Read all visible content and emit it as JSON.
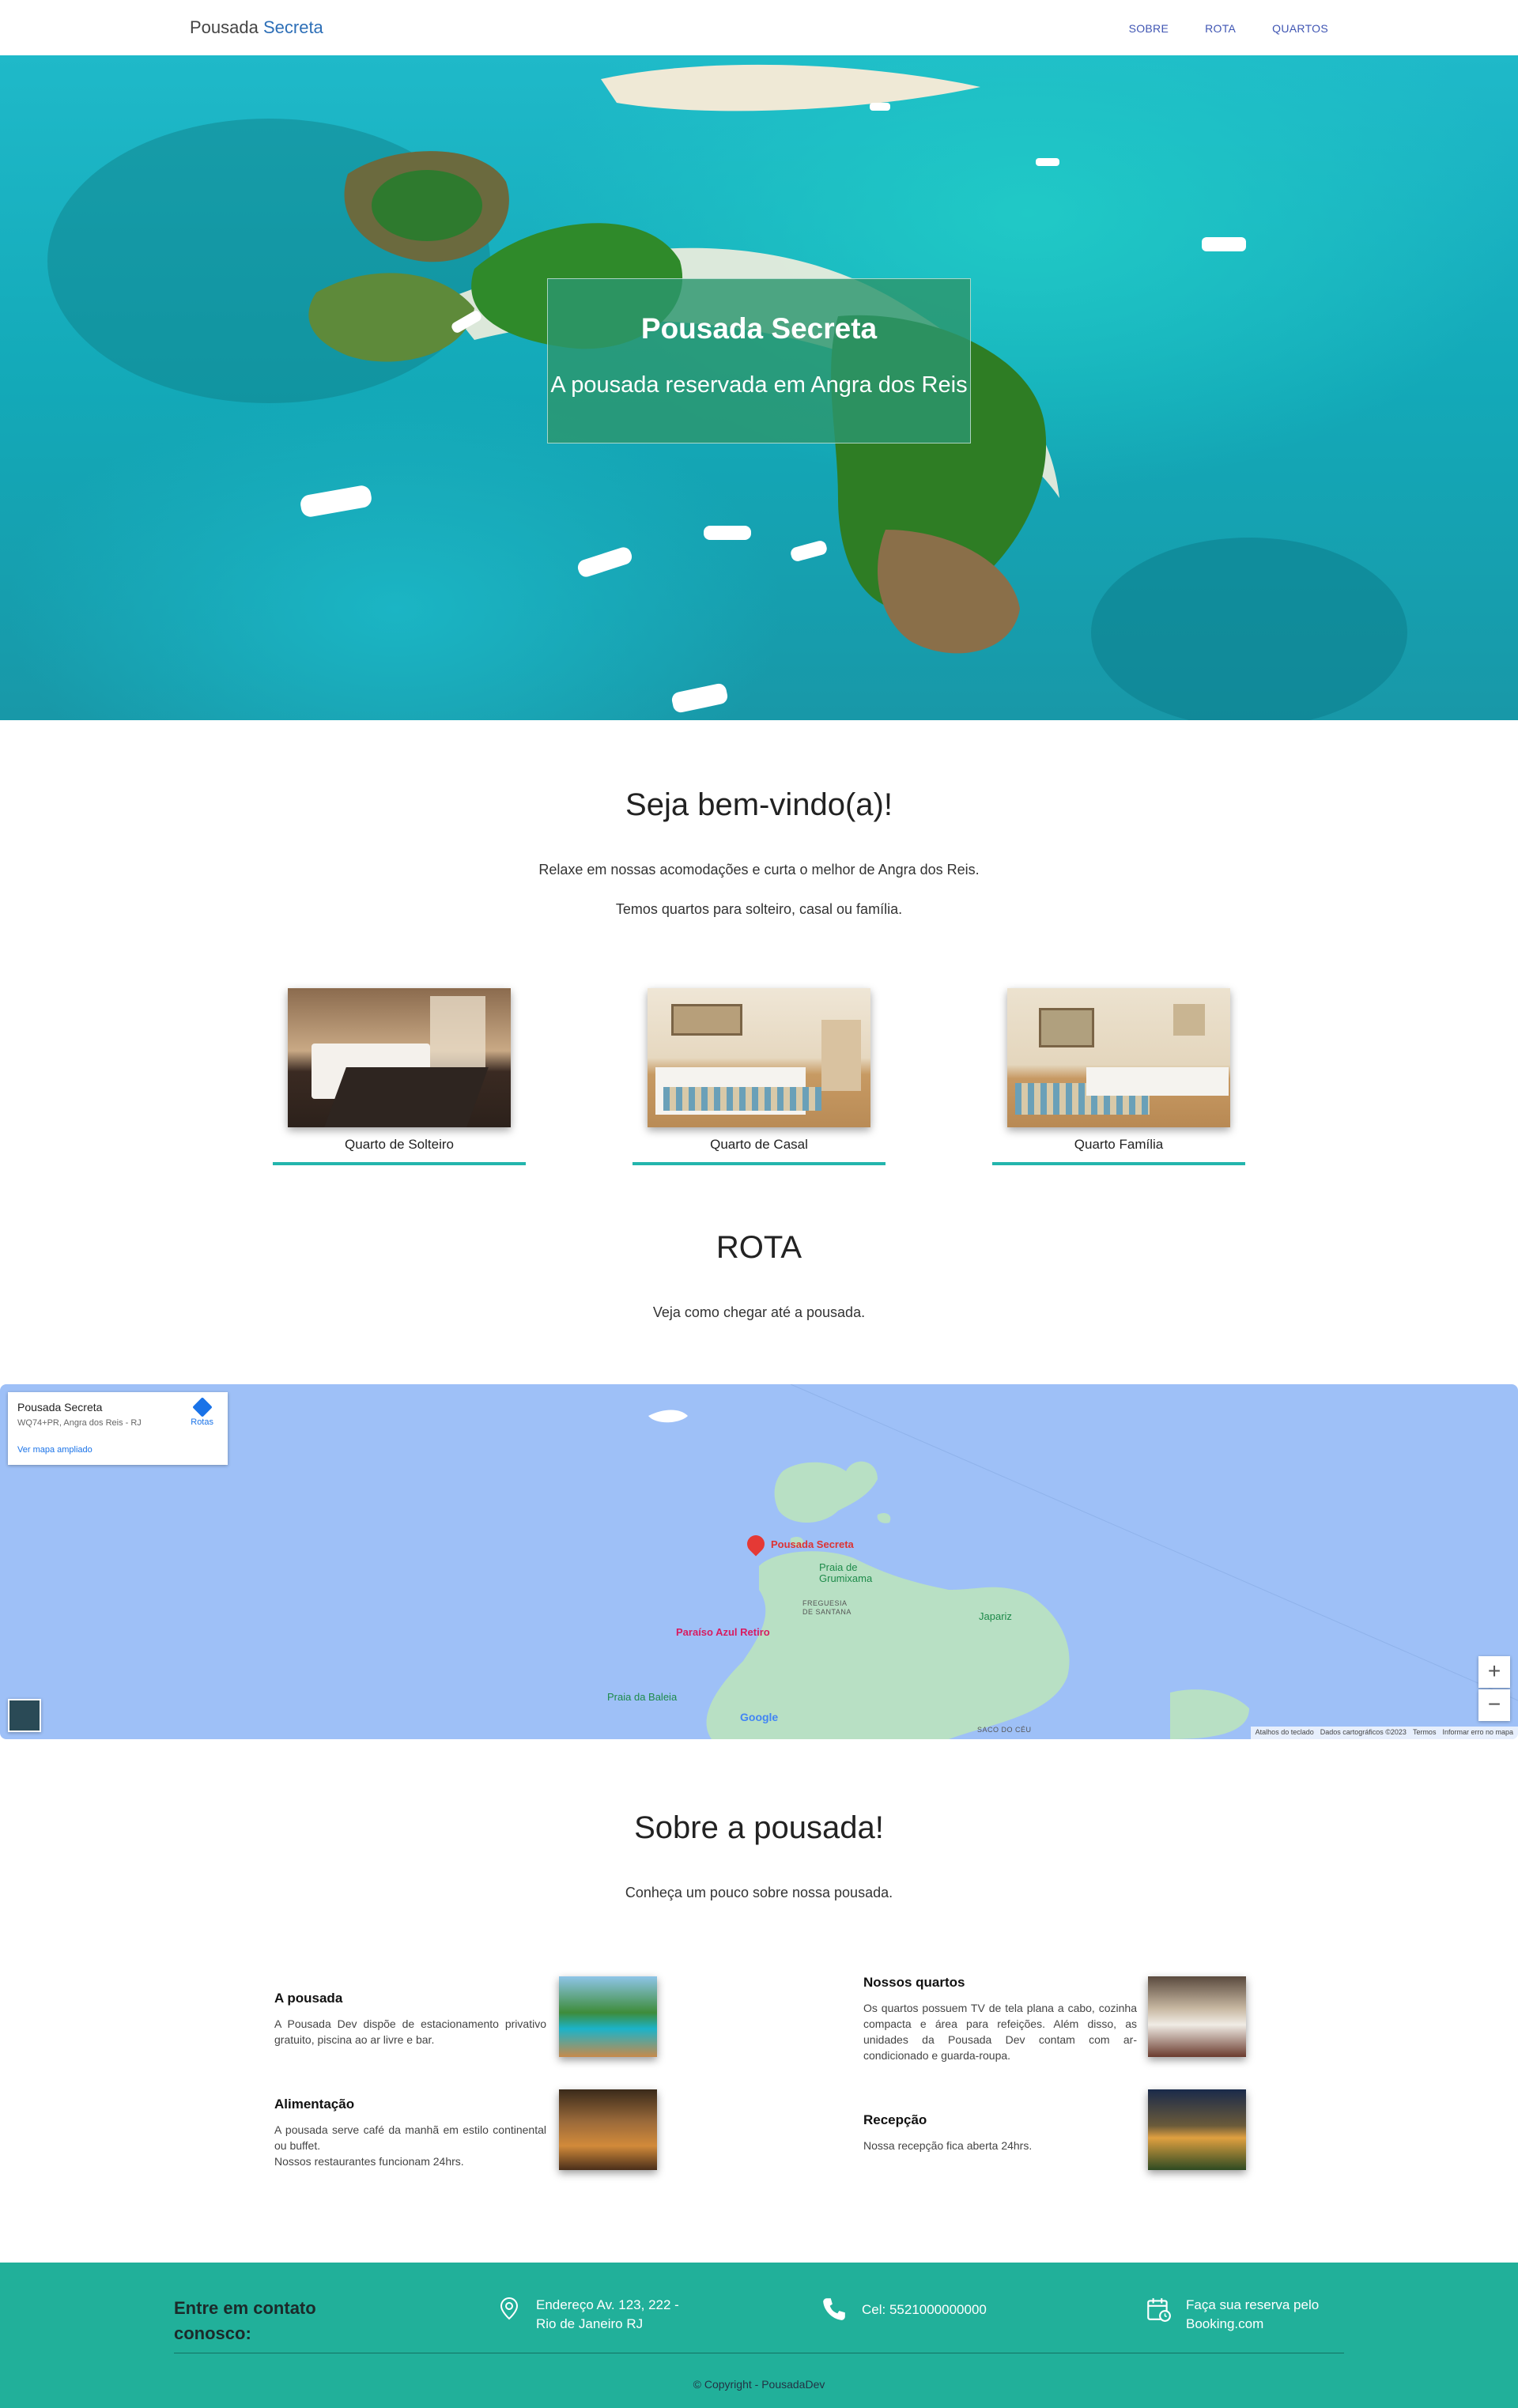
{
  "nav": {
    "brand_main": "Pousada ",
    "brand_accent": "Secreta",
    "links": [
      "SOBRE",
      "ROTA",
      "QUARTOS"
    ]
  },
  "hero": {
    "title": "Pousada Secreta",
    "subtitle": "A pousada reservada em Angra dos Reis"
  },
  "welcome": {
    "title": "Seja bem-vindo(a)!",
    "line1": "Relaxe em nossas acomodações e curta o melhor de Angra dos Reis.",
    "line2": "Temos quartos para solteiro, casal ou família."
  },
  "rooms": [
    {
      "label": "Quarto de Solteiro"
    },
    {
      "label": "Quarto de Casal"
    },
    {
      "label": "Quarto Família"
    }
  ],
  "route": {
    "title": "ROTA",
    "text": "Veja como chegar até a pousada."
  },
  "map": {
    "place_name": "Pousada Secreta",
    "address": "WQ74+PR, Angra dos Reis - RJ",
    "larger_map_link": "Ver mapa ampliado",
    "directions_label": "Rotas",
    "labels": {
      "pin": "Pousada Secreta",
      "beach1": "Praia de Grumixama",
      "district": "FREGUESIA DE SANTANA",
      "hotel": "Paraíso Azul Retiro",
      "japariz": "Japariz",
      "baleia": "Praia da Baleia",
      "saco": "SACO DO CÉU",
      "google": "Google"
    },
    "footer": [
      "Atalhos do teclado",
      "Dados cartográficos ©2023",
      "Termos",
      "Informar erro no mapa"
    ],
    "zoom_in": "+",
    "zoom_out": "−"
  },
  "about": {
    "title": "Sobre a pousada!",
    "text": "Conheça um pouco sobre nossa pousada.",
    "items": [
      {
        "heading": "A pousada",
        "body": "A Pousada Dev dispõe de estacionamento privativo gratuito, piscina ao ar livre e bar."
      },
      {
        "heading": "Nossos quartos",
        "body": "Os quartos possuem TV de tela plana a cabo, cozinha compacta e área para refeições. Além disso, as unidades da Pousada Dev contam com ar-condicionado e guarda-roupa."
      },
      {
        "heading": "Alimentação",
        "body": "A pousada serve café da manhã em estilo continental ou buffet.",
        "body2": "Nossos restaurantes funcionam 24hrs."
      },
      {
        "heading": "Recepção",
        "body": "Nossa recepção fica aberta 24hrs."
      }
    ]
  },
  "footer": {
    "contact_title": "Entre em contato conosco:",
    "address_line1": "Endereço Av. 123, 222 -",
    "address_line2": "Rio de Janeiro RJ",
    "phone": "Cel: 5521000000000",
    "booking_line1": "Faça sua reserva pelo",
    "booking_line2": "Booking.com",
    "copyright": "© Copyright - PousadaDev"
  },
  "colors": {
    "accent": "#23b5ad",
    "footer_bg": "#21b09a",
    "nav_link": "#3f55b3",
    "hero_box": "#2c966e"
  },
  "icons": [
    "location-icon",
    "phone-icon",
    "calendar-icon",
    "map-pin-icon",
    "directions-icon"
  ]
}
